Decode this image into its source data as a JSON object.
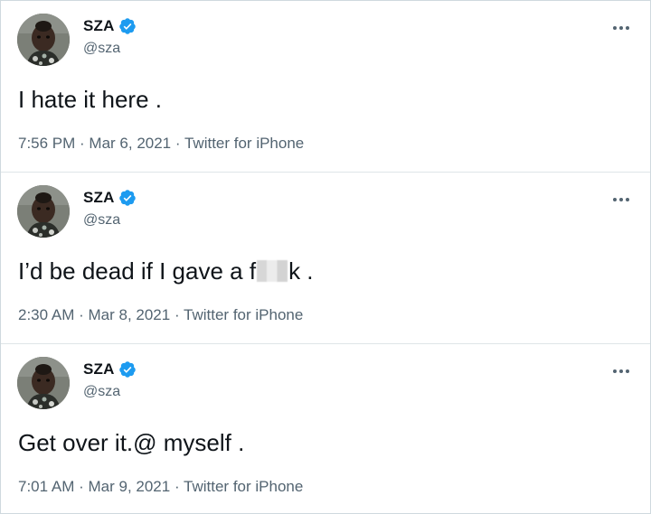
{
  "tweets": [
    {
      "name": "SZA",
      "handle": "@sza",
      "text": "I hate it here .",
      "time": "7:56 PM",
      "date": "Mar 6, 2021",
      "source": "Twitter for iPhone"
    },
    {
      "name": "SZA",
      "handle": "@sza",
      "text_before": "I’d be dead if I gave a f",
      "text_after": "k .",
      "time": "2:30 AM",
      "date": "Mar 8, 2021",
      "source": "Twitter for iPhone"
    },
    {
      "name": "SZA",
      "handle": "@sza",
      "text": "Get over it.@ myself .",
      "time": "7:01 AM",
      "date": "Mar 9, 2021",
      "source": "Twitter for iPhone"
    }
  ],
  "separator": " · ",
  "icons": {
    "verified": "verified-badge-icon",
    "more": "more-options-icon",
    "avatar": "profile-avatar"
  },
  "colors": {
    "text": "#0f1419",
    "secondary": "#536471",
    "verified": "#1d9bf0",
    "border": "#cfd9de"
  }
}
